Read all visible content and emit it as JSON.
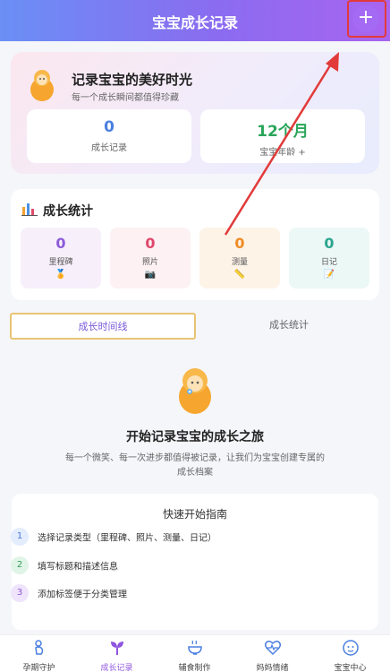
{
  "header": {
    "title": "宝宝成长记录",
    "add_label": "+"
  },
  "hero": {
    "title": "记录宝宝的美好时光",
    "subtitle": "每一个成长瞬间都值得珍藏",
    "records": {
      "value": "0",
      "label": "成长记录"
    },
    "age": {
      "value": "12个月",
      "label": "宝宝年龄 +"
    }
  },
  "stats": {
    "title": "成长统计",
    "items": [
      {
        "value": "0",
        "label": "里程碑",
        "icon": "🏅"
      },
      {
        "value": "0",
        "label": "照片",
        "icon": "📷"
      },
      {
        "value": "0",
        "label": "测量",
        "icon": "📏"
      },
      {
        "value": "0",
        "label": "日记",
        "icon": "📝"
      }
    ]
  },
  "tabs": {
    "active": "成长时间线",
    "inactive": "成长统计"
  },
  "empty": {
    "title": "开始记录宝宝的成长之旅",
    "description": "每一个微笑、每一次进步都值得被记录，让我们为宝宝创建专属的成长档案"
  },
  "guide": {
    "title": "快速开始指南",
    "steps": [
      {
        "num": "1",
        "text": "选择记录类型（里程碑、照片、测量、日记）"
      },
      {
        "num": "2",
        "text": "填写标题和描述信息"
      },
      {
        "num": "3",
        "text": "添加标签便于分类管理"
      }
    ]
  },
  "nav": [
    {
      "label": "孕期守护"
    },
    {
      "label": "成长记录"
    },
    {
      "label": "辅食制作"
    },
    {
      "label": "妈妈情绪"
    },
    {
      "label": "宝宝中心"
    }
  ],
  "colors": {
    "accent": "#8f55e0",
    "header_start": "#6a8ff5",
    "header_end": "#a864ef",
    "annotation": "#e23a3a"
  }
}
